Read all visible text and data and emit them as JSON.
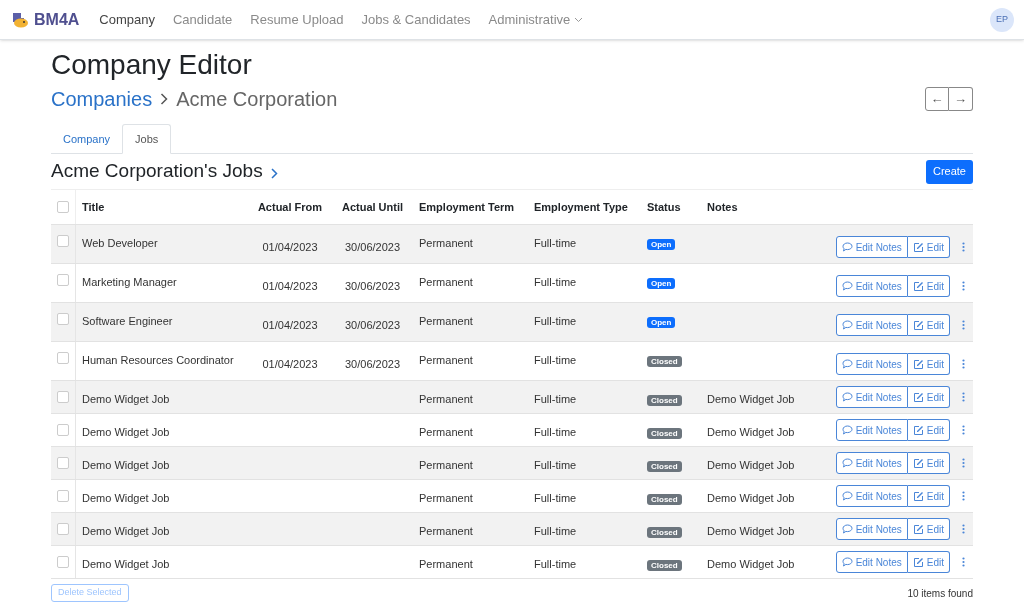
{
  "brand": "BM4A",
  "nav": [
    {
      "label": "Company",
      "selected": true,
      "dropdown": false
    },
    {
      "label": "Candidate",
      "selected": false,
      "dropdown": false
    },
    {
      "label": "Resume Upload",
      "selected": false,
      "dropdown": false
    },
    {
      "label": "Jobs & Candidates",
      "selected": false,
      "dropdown": false
    },
    {
      "label": "Administrative",
      "selected": false,
      "dropdown": true
    }
  ],
  "user_initials": "EP",
  "page_title": "Company Editor",
  "breadcrumb": [
    "Companies",
    "Acme Corporation"
  ],
  "pager": [
    "←",
    "→"
  ],
  "tabs": [
    {
      "label": "Company",
      "selected": false
    },
    {
      "label": "Jobs",
      "selected": true
    }
  ],
  "section_title": "Acme Corporation's Jobs",
  "create_button": "Create",
  "table": {
    "all_checked": false,
    "columns": [
      "Title",
      "Actual From",
      "Actual Until",
      "Employment Term",
      "Employment Type",
      "Status",
      "Notes"
    ],
    "rows": [
      {
        "checked": false,
        "title": "Web Developer",
        "actual_from": "01/04/2023",
        "actual_until": "30/06/2023",
        "term": "Permanent",
        "type": "Full-time",
        "status": {
          "label": "Open",
          "kind": "open"
        },
        "actions": [
          "Edit Notes",
          "Edit"
        ]
      },
      {
        "checked": false,
        "title": "Marketing Manager",
        "actual_from": "01/04/2023",
        "actual_until": "30/06/2023",
        "term": "Permanent",
        "type": "Full-time",
        "status": {
          "label": "Open",
          "kind": "open"
        },
        "actions": [
          "Edit Notes",
          "Edit"
        ]
      },
      {
        "checked": false,
        "title": "Software Engineer",
        "actual_from": "01/04/2023",
        "actual_until": "30/06/2023",
        "term": "Permanent",
        "type": "Full-time",
        "status": {
          "label": "Open",
          "kind": "open"
        },
        "actions": [
          "Edit Notes",
          "Edit"
        ]
      },
      {
        "checked": false,
        "title": "Human Resources Coordinator",
        "actual_from": "01/04/2023",
        "actual_until": "30/06/2023",
        "term": "Permanent",
        "type": "Full-time",
        "status": {
          "label": "Closed",
          "kind": "closed"
        },
        "actions": [
          "Edit Notes",
          "Edit"
        ]
      },
      {
        "checked": false,
        "title": "Demo Widget Job",
        "term": "Permanent",
        "type": "Full-time",
        "status": {
          "label": "Closed",
          "kind": "closed"
        },
        "notes": "Demo Widget Job",
        "actions": [
          "Edit Notes",
          "Edit"
        ]
      },
      {
        "checked": false,
        "title": "Demo Widget Job",
        "term": "Permanent",
        "type": "Full-time",
        "status": {
          "label": "Closed",
          "kind": "closed"
        },
        "notes": "Demo Widget Job",
        "actions": [
          "Edit Notes",
          "Edit"
        ]
      },
      {
        "checked": false,
        "title": "Demo Widget Job",
        "term": "Permanent",
        "type": "Full-time",
        "status": {
          "label": "Closed",
          "kind": "closed"
        },
        "notes": "Demo Widget Job",
        "actions": [
          "Edit Notes",
          "Edit"
        ]
      },
      {
        "checked": false,
        "title": "Demo Widget Job",
        "term": "Permanent",
        "type": "Full-time",
        "status": {
          "label": "Closed",
          "kind": "closed"
        },
        "notes": "Demo Widget Job",
        "actions": [
          "Edit Notes",
          "Edit"
        ]
      },
      {
        "checked": false,
        "title": "Demo Widget Job",
        "term": "Permanent",
        "type": "Full-time",
        "status": {
          "label": "Closed",
          "kind": "closed"
        },
        "notes": "Demo Widget Job",
        "actions": [
          "Edit Notes",
          "Edit"
        ]
      },
      {
        "checked": false,
        "title": "Demo Widget Job",
        "term": "Permanent",
        "type": "Full-time",
        "status": {
          "label": "Closed",
          "kind": "closed"
        },
        "notes": "Demo Widget Job",
        "actions": [
          "Edit Notes",
          "Edit"
        ]
      }
    ]
  },
  "delete_button": "Delete Selected",
  "items_found": "10 items found"
}
